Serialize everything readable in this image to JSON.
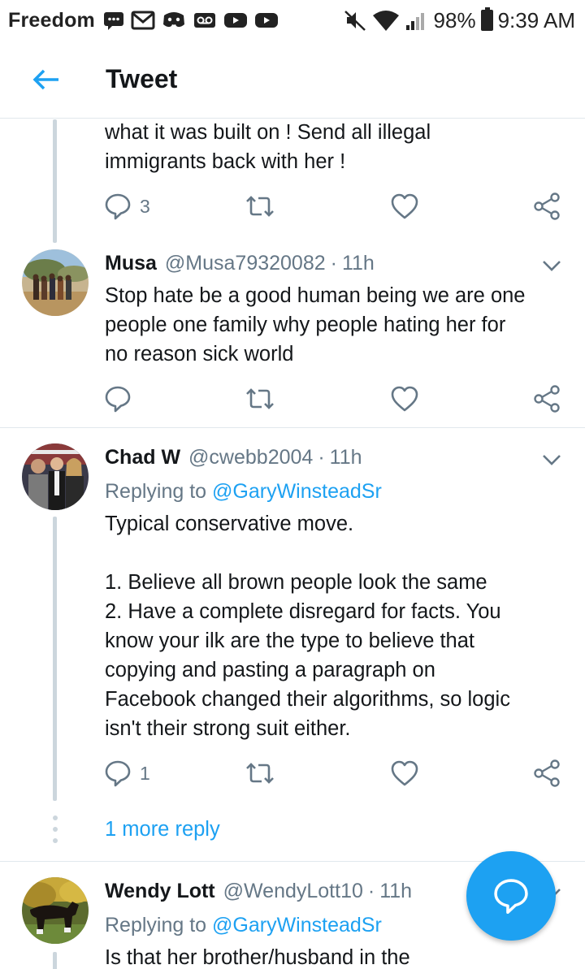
{
  "status_bar": {
    "carrier": "Freedom",
    "battery": "98%",
    "time": "9:39 AM",
    "icons": [
      "message-icon",
      "gmail-icon",
      "discord-icon",
      "voicemail-icon",
      "youtube-icon",
      "youtube-icon",
      "mute-icon",
      "wifi-icon",
      "signal-icon",
      "battery-icon"
    ]
  },
  "header": {
    "title": "Tweet",
    "back_icon": "arrow-left-icon"
  },
  "colors": {
    "accent": "#1da1f2",
    "secondary_text": "#657786",
    "divider": "#e1e8ed",
    "thread_line": "#ccd6dd"
  },
  "tweets": [
    {
      "text": "what it was built on !  Send all illegal\nimmigrants back with her !",
      "reply_count": "3",
      "retweet_count": "",
      "like_count": ""
    },
    {
      "name": "Musa",
      "handle": "@Musa79320082",
      "time": "11h",
      "text": "Stop hate be a good human being we are one\npeople one family why people hating her for\nno reason sick world",
      "reply_count": "",
      "retweet_count": "",
      "like_count": ""
    },
    {
      "name": "Chad W",
      "handle": "@cwebb2004",
      "time": "11h",
      "replying_prefix": "Replying to",
      "replying_to": "@GaryWinsteadSr",
      "text": "Typical conservative move.\n\n1. Believe all brown people look the same\n2. Have a complete disregard for facts. You\nknow your ilk are the type to believe that\ncopying and pasting a paragraph on\nFacebook changed their algorithms, so logic\nisn't their strong suit either.",
      "reply_count": "1",
      "retweet_count": "",
      "like_count": ""
    },
    {
      "name": "Wendy Lott",
      "handle": "@WendyLott10",
      "time": "11h",
      "replying_prefix": "Replying to",
      "replying_to": "@GaryWinsteadSr",
      "text": "Is that her brother/husband in the"
    }
  ],
  "more_reply": "1 more reply",
  "separator_dot": "·"
}
